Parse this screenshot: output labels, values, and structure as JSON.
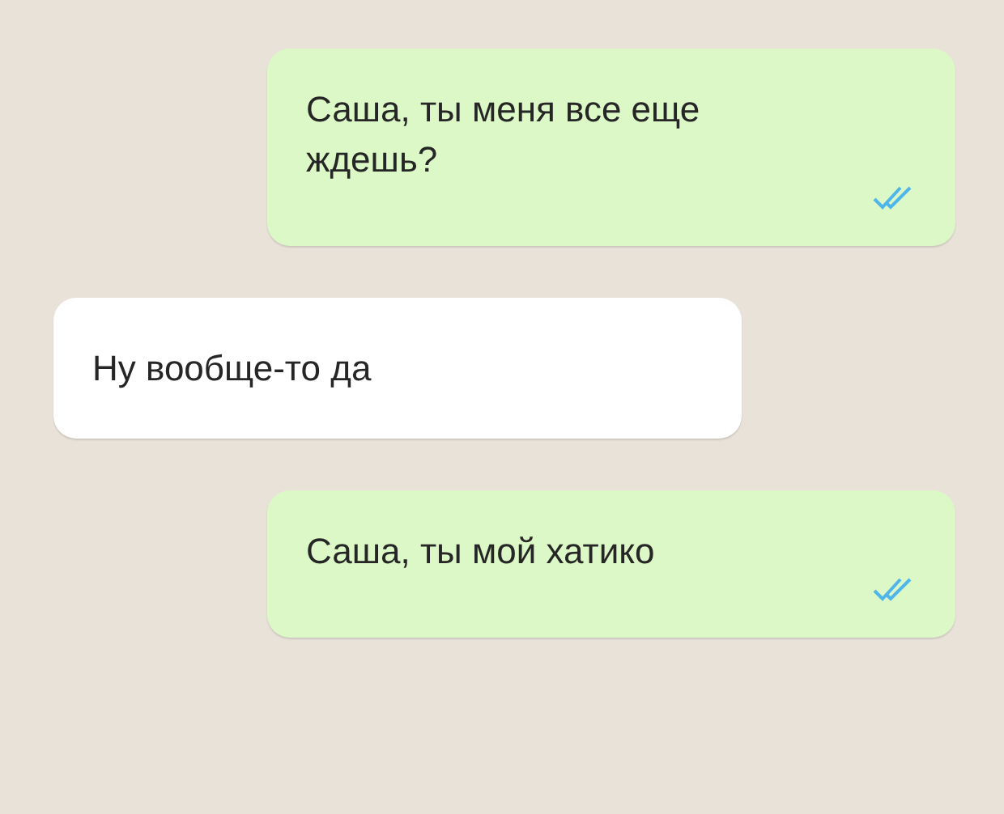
{
  "messages": [
    {
      "kind": "outgoing",
      "text": "Саша, ты меня все еще ждешь?",
      "read": true
    },
    {
      "kind": "incoming",
      "text": "Ну вообще-то да"
    },
    {
      "kind": "outgoing",
      "text": "Саша, ты мой хатико",
      "read": true
    }
  ]
}
